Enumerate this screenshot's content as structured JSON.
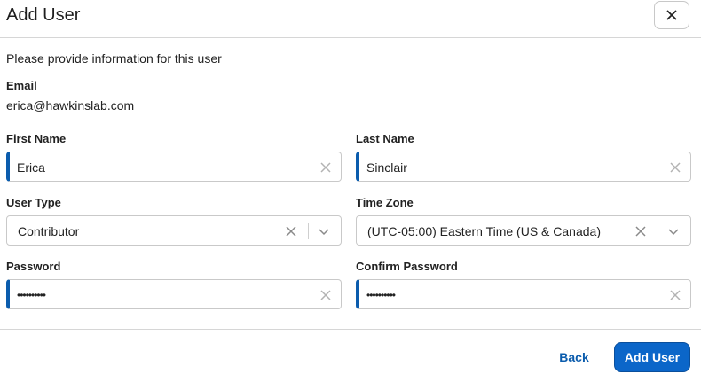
{
  "dialog": {
    "title": "Add User",
    "intro": "Please provide information for this user"
  },
  "email": {
    "label": "Email",
    "value": "erica@hawkinslab.com"
  },
  "fields": {
    "first_name": {
      "label": "First Name",
      "value": "Erica"
    },
    "last_name": {
      "label": "Last Name",
      "value": "Sinclair"
    },
    "user_type": {
      "label": "User Type",
      "value": "Contributor"
    },
    "time_zone": {
      "label": "Time Zone",
      "value": "(UTC-05:00) Eastern Time (US & Canada)"
    },
    "password": {
      "label": "Password",
      "value": "••••••••••"
    },
    "confirm_password": {
      "label": "Confirm Password",
      "value": "••••••••••"
    }
  },
  "footer": {
    "back_label": "Back",
    "add_label": "Add User"
  },
  "colors": {
    "accent": "#0b5cad",
    "primary_button": "#0b66c9"
  },
  "icons": {
    "close": "close-icon",
    "clear": "clear-icon",
    "dropdown": "chevron-down-icon"
  }
}
